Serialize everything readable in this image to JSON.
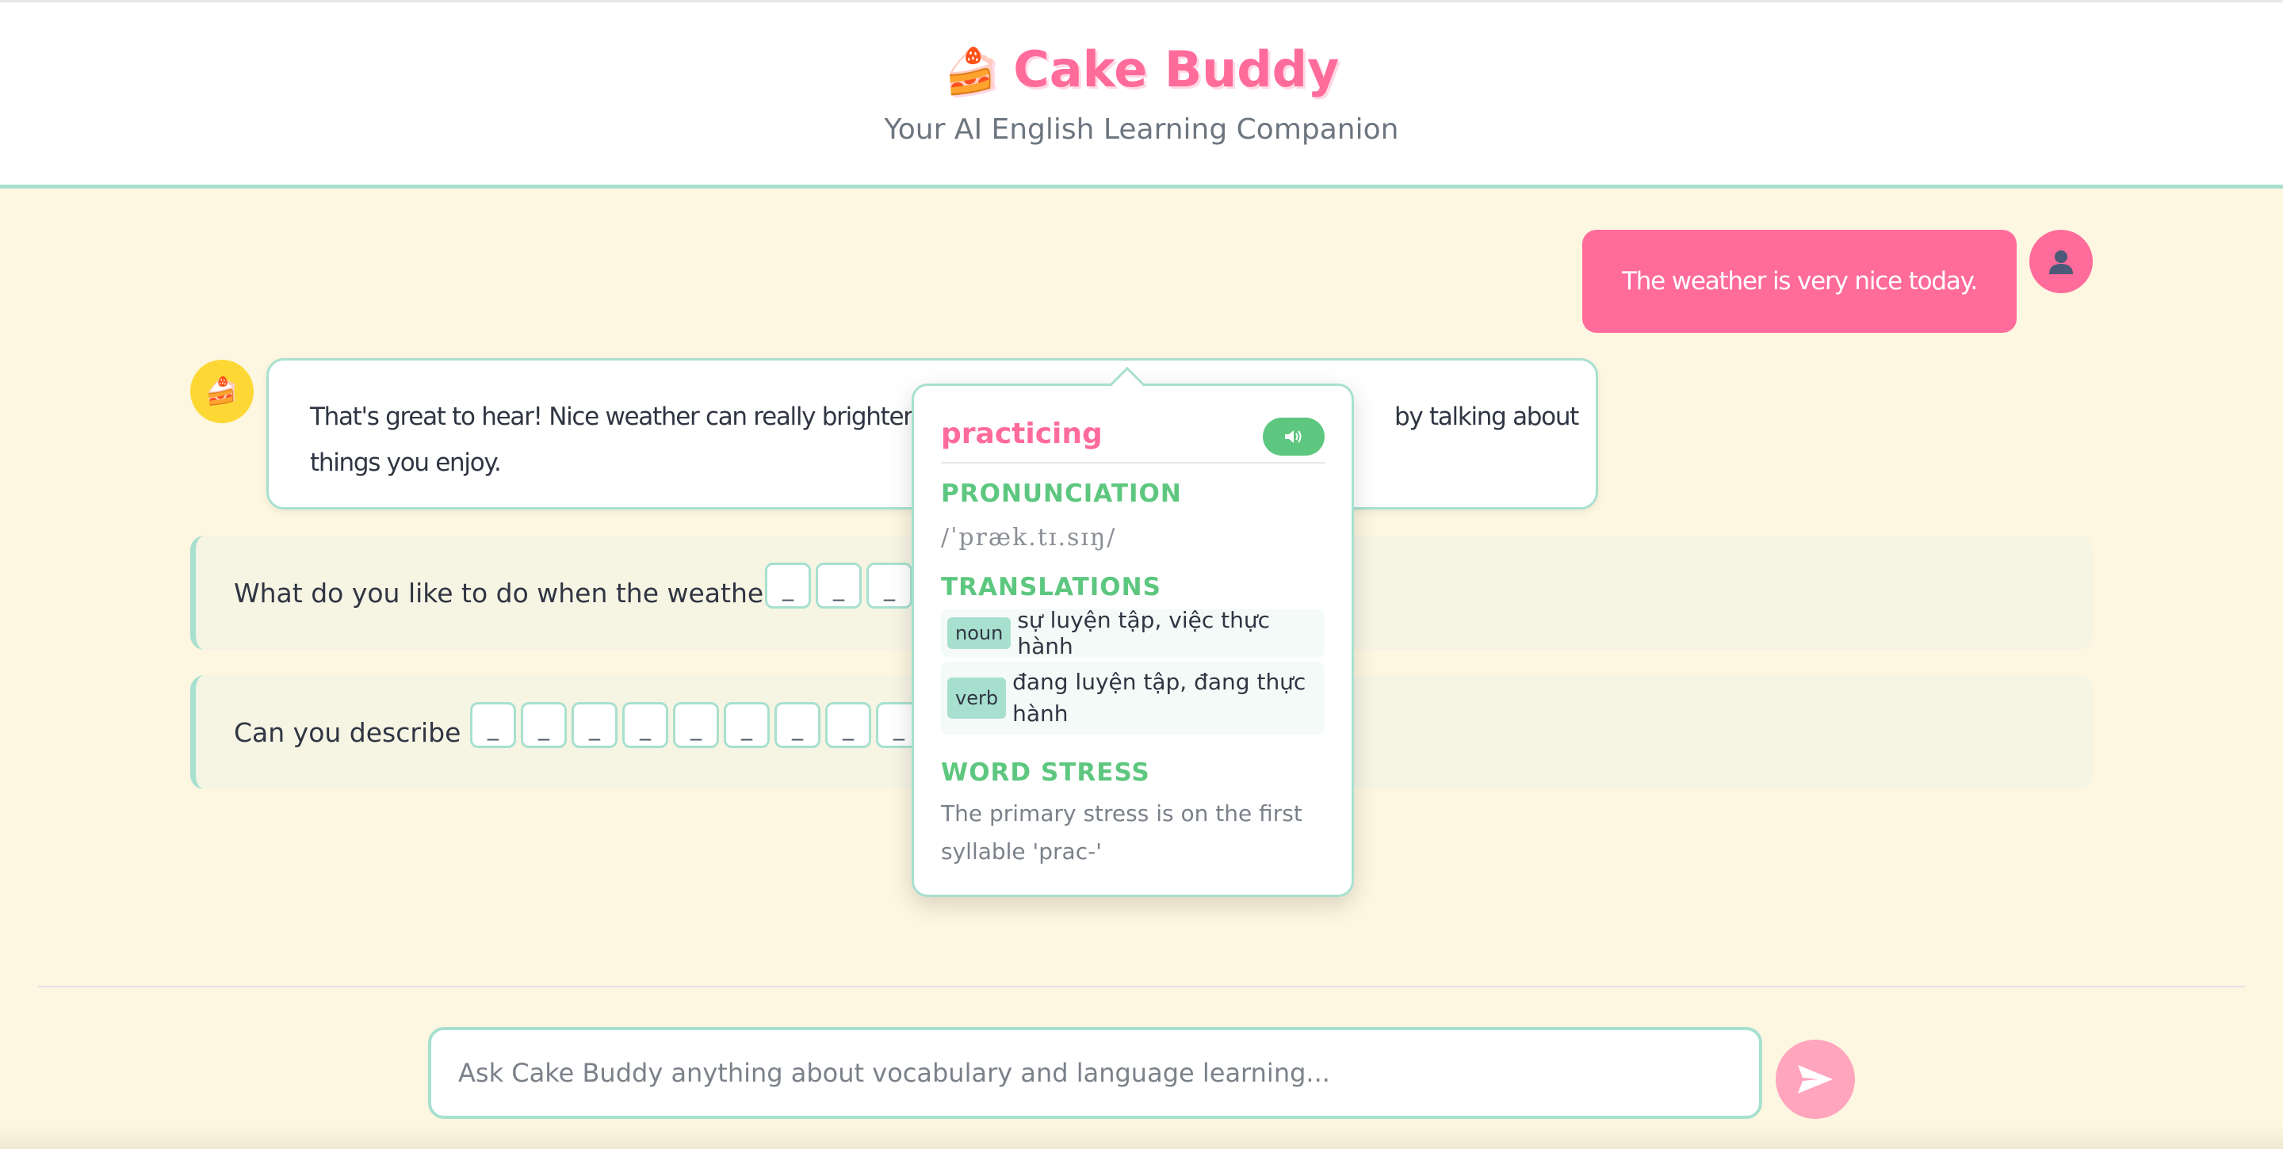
{
  "header": {
    "icon": "cake-icon",
    "icon_glyph": "🍰",
    "title": "Cake Buddy",
    "subtitle": "Your AI English Learning Companion"
  },
  "colors": {
    "accent_pink": "#ff6b9a",
    "mint": "#a8e0cf",
    "green": "#5dc77f",
    "background": "#fdf6e0"
  },
  "messages": {
    "user": {
      "text": "The weather is very nice today.",
      "avatar_icon": "user-icon"
    },
    "bot": {
      "avatar_icon": "cake-icon",
      "avatar_glyph": "🍰",
      "line1_left": "That's great to hear! Nice weather can really brighten",
      "line1_right": "by talking about",
      "line2": "things you enjoy."
    }
  },
  "questions": [
    {
      "text": "What do you like to do when the weather is",
      "blanks": [
        "_",
        "_",
        "_"
      ]
    },
    {
      "text": "Can you describe a",
      "blanks": [
        "_",
        "_",
        "_",
        "_",
        "_",
        "_",
        "_",
        "_",
        "_"
      ]
    }
  ],
  "popup": {
    "word": "practicing",
    "speak_icon": "speaker-icon",
    "pronunciation_label": "PRONUNCIATION",
    "ipa": "/ˈpræk.tɪ.sɪŋ/",
    "translations_label": "TRANSLATIONS",
    "translations": [
      {
        "pos": "noun",
        "meaning": "sự luyện tập, việc thực hành"
      },
      {
        "pos": "verb",
        "meaning": "đang luyện tập, đang thực hành"
      }
    ],
    "stress_label": "WORD STRESS",
    "stress_text": "The primary stress is on the first syllable 'prac-'"
  },
  "input": {
    "placeholder": "Ask Cake Buddy anything about vocabulary and language learning...",
    "value": "",
    "send_icon": "send-icon"
  }
}
